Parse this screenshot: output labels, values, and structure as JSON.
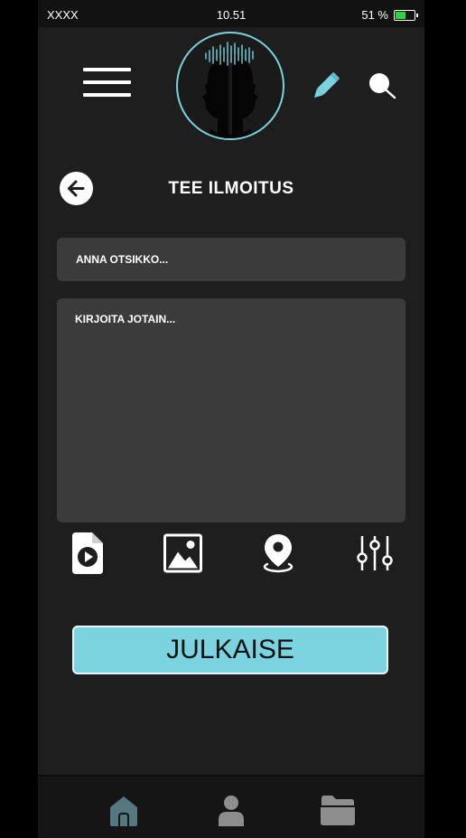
{
  "status_bar": {
    "carrier": "XXXX",
    "time": "10.51",
    "battery_percent": "51 %",
    "battery_level": 0.51,
    "battery_color": "#2fd13f"
  },
  "header": {
    "menu_icon": "hamburger-menu-icon",
    "logo_icon": "two-faces-soundwave-logo",
    "edit_icon": "pencil-icon",
    "search_icon": "search-icon",
    "accent_color": "#7ad3df"
  },
  "page": {
    "back_icon": "arrow-left-icon",
    "title": "TEE ILMOITUS"
  },
  "form": {
    "title_placeholder": "ANNA OTSIKKO...",
    "title_value": "",
    "body_placeholder": "KIRJOITA JOTAIN...",
    "body_value": ""
  },
  "toolbar": {
    "items": [
      {
        "icon": "video-file-icon"
      },
      {
        "icon": "image-icon"
      },
      {
        "icon": "location-pin-icon"
      },
      {
        "icon": "sliders-icon"
      }
    ]
  },
  "publish": {
    "label": "JULKAISE"
  },
  "bottom_nav": {
    "items": [
      {
        "icon": "home-icon",
        "active": true
      },
      {
        "icon": "profile-icon",
        "active": false
      },
      {
        "icon": "folder-icon",
        "active": false
      }
    ]
  }
}
